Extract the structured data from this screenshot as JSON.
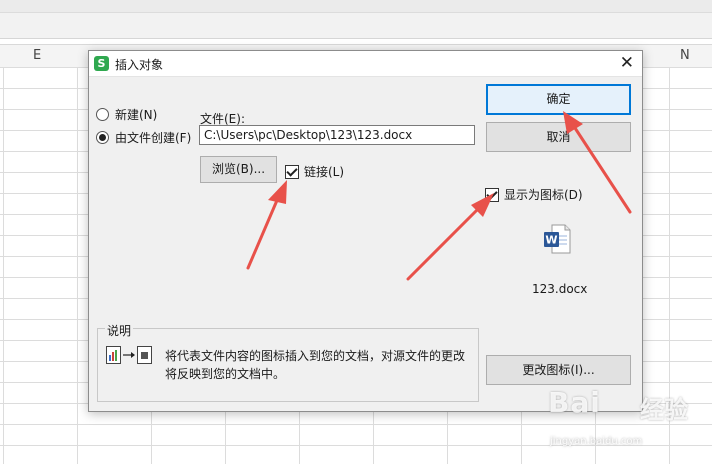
{
  "spreadsheet": {
    "column_letters": [
      "E",
      "N"
    ]
  },
  "dialog": {
    "app_icon": "S",
    "title": "插入对象",
    "close_symbol": "✕",
    "options": {
      "create_new": "新建(N)",
      "create_from_file": "由文件创建(F)",
      "selected": "create_from_file"
    },
    "file_label": "文件(E):",
    "file_path": "C:\\Users\\pc\\Desktop\\123\\123.docx",
    "browse_label": "浏览(B)...",
    "link": {
      "label": "链接(L)",
      "checked": true
    },
    "display_as_icon": {
      "label": "显示为图标(D)",
      "checked": true
    },
    "icon_filename": "123.docx",
    "ok_label": "确定",
    "cancel_label": "取消",
    "change_icon_label": "更改图标(I)...",
    "description": {
      "title": "说明",
      "text": "将代表文件内容的图标插入到您的文档，对源文件的更改将反映到您的文档中。"
    }
  },
  "annotations": {
    "arrow_color": "#e8514a"
  },
  "watermark": {
    "brand": "Bai",
    "brand2": "经验",
    "url": "jingyan.baidu.com"
  },
  "colors": {
    "accent": "#0078d7",
    "word_blue": "#2b5797",
    "app_green": "#2fa84f"
  }
}
